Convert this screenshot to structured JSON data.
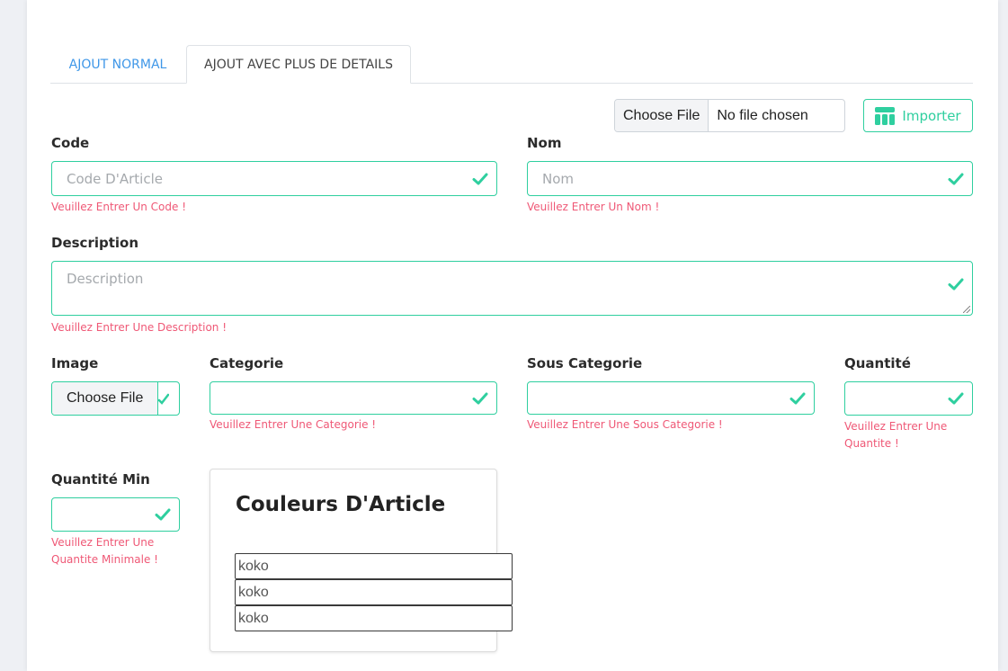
{
  "tabs": [
    {
      "label": "AJOUT NORMAL",
      "active": false
    },
    {
      "label": "AJOUT AVEC PLUS DE DETAILS",
      "active": true
    }
  ],
  "file_import": {
    "choose_label": "Choose File",
    "status": "No file chosen",
    "import_label": "Importer"
  },
  "fields": {
    "code": {
      "label": "Code",
      "placeholder": "Code D'Article",
      "error": "Veuillez Entrer Un Code !"
    },
    "nom": {
      "label": "Nom",
      "placeholder": "Nom",
      "error": "Veuillez Entrer Un Nom !"
    },
    "description": {
      "label": "Description",
      "placeholder": "Description",
      "error": "Veuillez Entrer Une Description !"
    },
    "image": {
      "label": "Image",
      "choose_label": "Choose File"
    },
    "categorie": {
      "label": "Categorie",
      "value": "",
      "error": "Veuillez Entrer Une Categorie !"
    },
    "sous_categorie": {
      "label": "Sous Categorie",
      "value": "",
      "error": "Veuillez Entrer Une Sous Categorie !"
    },
    "quantite": {
      "label": "Quantité",
      "value": "",
      "error_line1": "Veuillez Entrer Une",
      "error_line2": "Quantite !"
    },
    "quantite_min": {
      "label": "Quantité Min",
      "value": "",
      "error_line1": "Veuillez Entrer Une",
      "error_line2": "Quantite Minimale !"
    }
  },
  "colors": {
    "title": "Couleurs D'Article",
    "items": [
      "koko",
      "koko",
      "koko"
    ]
  },
  "theme": {
    "accent": "#2fcf9f",
    "error": "#ef5876",
    "link": "#3f97e8"
  }
}
